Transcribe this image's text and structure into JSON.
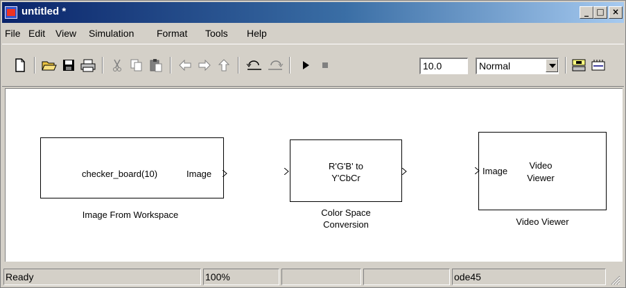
{
  "window": {
    "title": "untitled *"
  },
  "caption_buttons": {
    "minimize": "_",
    "maximize": "□",
    "close": "×"
  },
  "menu": [
    {
      "label": "File"
    },
    {
      "label": "Edit"
    },
    {
      "label": "View"
    },
    {
      "label": "Simulation"
    },
    {
      "label": "Format"
    },
    {
      "label": "Tools"
    },
    {
      "label": "Help"
    }
  ],
  "toolbar": {
    "icons": [
      "new-icon",
      "open-icon",
      "save-icon",
      "print-icon",
      "cut-icon",
      "copy-icon",
      "paste-icon",
      "back-arrow-icon",
      "forward-arrow-icon",
      "up-arrow-icon",
      "undo-icon",
      "redo-icon",
      "play-icon",
      "stop-icon",
      "library-browser-icon",
      "model-browser-icon"
    ],
    "stop_time": "10.0",
    "sim_mode": "Normal",
    "sim_mode_options": [
      "Normal"
    ]
  },
  "blocks": {
    "image_from_workspace": {
      "param": "checker_board(10)",
      "out_port": "Image",
      "caption": "Image From Workspace"
    },
    "color_space_conversion": {
      "line1": "R'G'B' to",
      "line2": "Y'CbCr",
      "caption_line1": "Color Space",
      "caption_line2": "Conversion"
    },
    "video_viewer": {
      "in_port": "Image",
      "line1": "Video",
      "line2": "Viewer",
      "caption": "Video Viewer"
    }
  },
  "status": {
    "state": "Ready",
    "zoom": "100%",
    "blank1": "",
    "blank2": "",
    "solver": "ode45"
  }
}
